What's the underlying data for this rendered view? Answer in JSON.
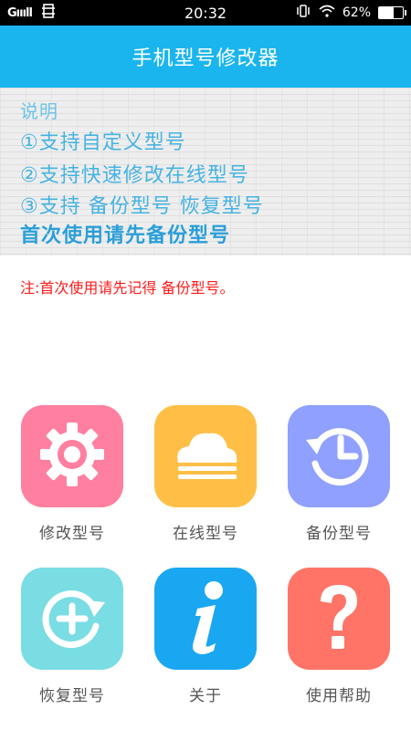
{
  "status_bar": {
    "signal": "Gıııll",
    "time": "20:32",
    "battery": "62%",
    "battery_level": 0.62
  },
  "header": {
    "title": "手机型号修改器"
  },
  "banner": {
    "lines": [
      "说明",
      "①支持自定义型号",
      "②支持快速修改在线型号",
      "③支持 备份型号 恢复型号",
      "首次使用请先备份型号"
    ]
  },
  "note": "注:首次使用请先记得 备份型号。",
  "tiles": [
    {
      "label": "修改型号",
      "icon": "gear-icon",
      "color": "#ff7fa0"
    },
    {
      "label": "在线型号",
      "icon": "cloud-icon",
      "color": "#ffbf47"
    },
    {
      "label": "备份型号",
      "icon": "history-clock-icon",
      "color": "#8fa0ff"
    },
    {
      "label": "恢复型号",
      "icon": "restore-plus-icon",
      "color": "#79dde3"
    },
    {
      "label": "关于",
      "icon": "info-icon",
      "color": "#1aa7f2"
    },
    {
      "label": "使用帮助",
      "icon": "help-question-icon",
      "color": "#ff7466"
    }
  ]
}
